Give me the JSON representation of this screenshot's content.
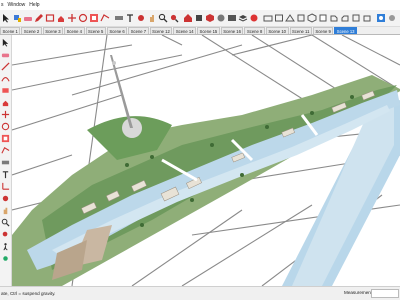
{
  "menu": [
    "s",
    "Window",
    "Help"
  ],
  "toolbar": {
    "icons": [
      "select-icon",
      "paint-icon",
      "eraser-icon",
      "pencil-icon",
      "shape-icon",
      "push-pull-icon",
      "move-icon",
      "rotate-icon",
      "scale-icon",
      "offset-icon",
      "tape-icon",
      "text-icon",
      "orbit-icon",
      "pan-icon",
      "zoom-icon",
      "zoom-extents-icon",
      "warehouse-icon",
      "extension-icon",
      "components-icon",
      "materials-icon",
      "styles-icon",
      "layers-icon",
      "section-icon",
      "camera-icon",
      "walk-icon",
      "look-icon",
      "position-icon",
      "iso-view-icon",
      "top-view-icon",
      "front-view-icon",
      "right-view-icon",
      "back-view-icon",
      "left-view-icon",
      "shadow-icon",
      "shadow-settings-icon",
      "fog-icon"
    ],
    "accent": "#2f7ed8"
  },
  "scenes": {
    "tabs": [
      "Scene 1",
      "Scene 2",
      "Scene 3",
      "Scene 4",
      "Scene 5",
      "Scene 6",
      "Scene 7",
      "Scene 12",
      "Scene 14",
      "Scene 15",
      "Scene 16",
      "Scene 8",
      "Scene 10",
      "Scene 11",
      "Scene 9",
      "Scene 13"
    ],
    "active_index": 15
  },
  "status": {
    "hint": "ate, Ctrl = suspend gravity.",
    "measurements_label": "Measurement",
    "measurements_value": ""
  }
}
